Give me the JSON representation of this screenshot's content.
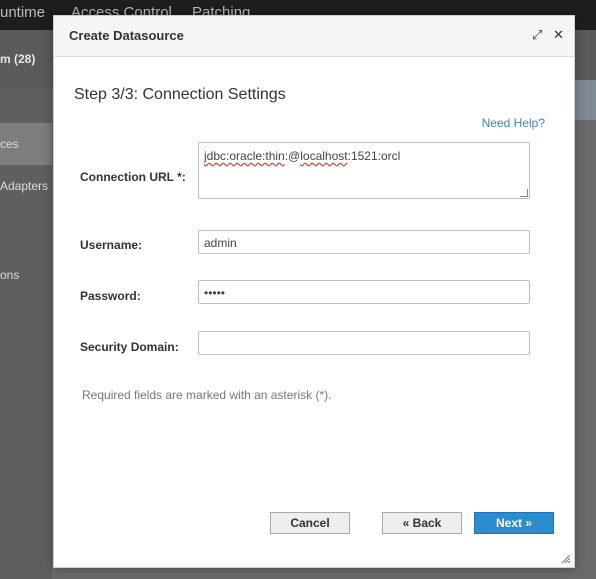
{
  "background": {
    "nav": [
      "untime",
      "Access Control",
      "Patching"
    ],
    "crumb": "m (28)",
    "sidebar": [
      "ces",
      "Adapters",
      "ons"
    ]
  },
  "dialog": {
    "title": "Create Datasource",
    "step_title": "Step 3/3: Connection Settings",
    "help_link": "Need Help?",
    "fields": {
      "connection_url": {
        "label": "Connection URL *:",
        "value_parts": [
          "jdbc:oracle:thin",
          ":@",
          "localhost",
          ":1521:",
          "orcl"
        ]
      },
      "username": {
        "label": "Username:",
        "value": "admin"
      },
      "password": {
        "label": "Password:",
        "value": "•••••"
      },
      "security_domain": {
        "label": "Security Domain:",
        "value": ""
      }
    },
    "required_note": "Required fields are marked with an asterisk (*).",
    "buttons": {
      "cancel": "Cancel",
      "back": "« Back",
      "next": "Next »"
    },
    "icons": {
      "maximize": "expand-icon",
      "close": "close-icon"
    }
  }
}
